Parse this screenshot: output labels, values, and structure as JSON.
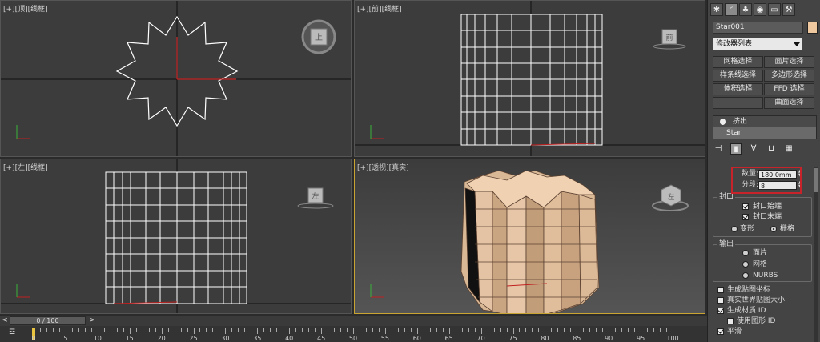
{
  "viewports": {
    "top": "[+][顶][线框]",
    "front": "[+][前][线框]",
    "left": "[+][左][线框]",
    "persp": "[+][透视][真实]"
  },
  "viewcube": {
    "top": "上",
    "front": "前",
    "left": "左",
    "persp": "左"
  },
  "panel": {
    "tab_icons": [
      "create-icon",
      "modify-icon",
      "hierarchy-icon",
      "motion-icon",
      "display-icon",
      "utilities-icon"
    ],
    "object_name": "Star001",
    "object_color": "#f0c8a0",
    "modifier_list": "修改器列表",
    "selection_buttons": [
      "网格选择",
      "面片选择",
      "样条线选择",
      "多边形选择",
      "体积选择",
      "FFD 选择",
      "",
      "曲面选择"
    ],
    "stack": {
      "modifier": "挤出",
      "base": "Star"
    },
    "params": {
      "amount_label": "数量:",
      "amount_value": "180.0mm",
      "segments_label": "分段:",
      "segments_value": "8"
    },
    "capping": {
      "title": "封口",
      "cap_start": "封口始端",
      "cap_end": "封口末端",
      "morph": "变形",
      "grid": "栅格"
    },
    "output": {
      "title": "输出",
      "patch": "面片",
      "mesh": "网格",
      "nurbs": "NURBS"
    },
    "options": {
      "gen_mapping": "生成贴图坐标",
      "real_world": "真实世界贴图大小",
      "gen_mat_ids": "生成材质 ID",
      "use_shape_ids": "使用图形 ID",
      "smooth": "平滑"
    }
  },
  "timeline": {
    "frame_display": "0 / 100",
    "ticks": [
      "0",
      "5",
      "10",
      "15",
      "20",
      "25",
      "30",
      "35",
      "40",
      "45",
      "50",
      "55",
      "60",
      "65",
      "70",
      "75",
      "80",
      "85",
      "90",
      "95",
      "100"
    ]
  }
}
